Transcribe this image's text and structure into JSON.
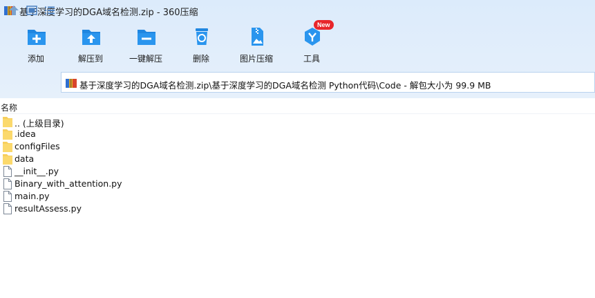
{
  "window": {
    "title": "基于深度学习的DGA域名检测.zip - 360压缩",
    "app_icon": "archive-icon"
  },
  "toolbar": {
    "items": [
      {
        "label": "添加",
        "icon": "add-icon"
      },
      {
        "label": "解压到",
        "icon": "extract-to-icon"
      },
      {
        "label": "一键解压",
        "icon": "one-click-extract-icon"
      },
      {
        "label": "删除",
        "icon": "delete-icon"
      },
      {
        "label": "图片压缩",
        "icon": "image-compress-icon"
      },
      {
        "label": "工具",
        "icon": "tools-icon"
      }
    ],
    "new_badge": "New"
  },
  "address": {
    "path": "基于深度学习的DGA域名检测.zip\\基于深度学习的DGA域名检测 Python代码\\Code - 解包大小为 99.9 MB"
  },
  "columns": {
    "name": "名称"
  },
  "files": [
    {
      "name": ".. (上级目录)",
      "type": "folder"
    },
    {
      "name": ".idea",
      "type": "folder"
    },
    {
      "name": "configFiles",
      "type": "folder"
    },
    {
      "name": "data",
      "type": "folder"
    },
    {
      "name": "__init__.py",
      "type": "file"
    },
    {
      "name": "Binary_with_attention.py",
      "type": "file"
    },
    {
      "name": "main.py",
      "type": "file"
    },
    {
      "name": "resultAssess.py",
      "type": "file"
    }
  ],
  "colors": {
    "accent": "#2a8be6",
    "toolbar_bg": "#e2eefb",
    "folder": "#f7cf5c",
    "badge": "#e8262b"
  }
}
